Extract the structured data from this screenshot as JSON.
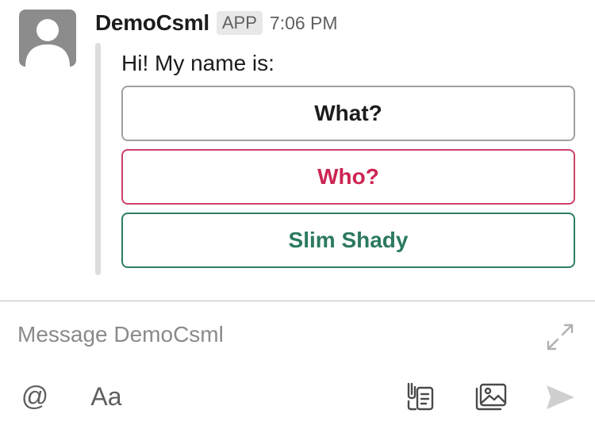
{
  "message": {
    "sender": "DemoCsml",
    "badge": "APP",
    "time": "7:06 PM",
    "text": "Hi! My name is:"
  },
  "buttons": [
    {
      "label": "What?",
      "style": "default",
      "color": "#1d1c1d"
    },
    {
      "label": "Who?",
      "style": "danger",
      "color": "#cd2553"
    },
    {
      "label": "Slim Shady",
      "style": "primary",
      "color": "#2b7a5e"
    }
  ],
  "composer": {
    "placeholder": "Message DemoCsml",
    "value": "",
    "format_label": "Aa",
    "mention_label": "@"
  },
  "icons": [
    "avatar-placeholder-icon",
    "expand-icon",
    "at-icon",
    "format-text-icon",
    "shortcuts-icon",
    "image-icon",
    "send-icon"
  ]
}
